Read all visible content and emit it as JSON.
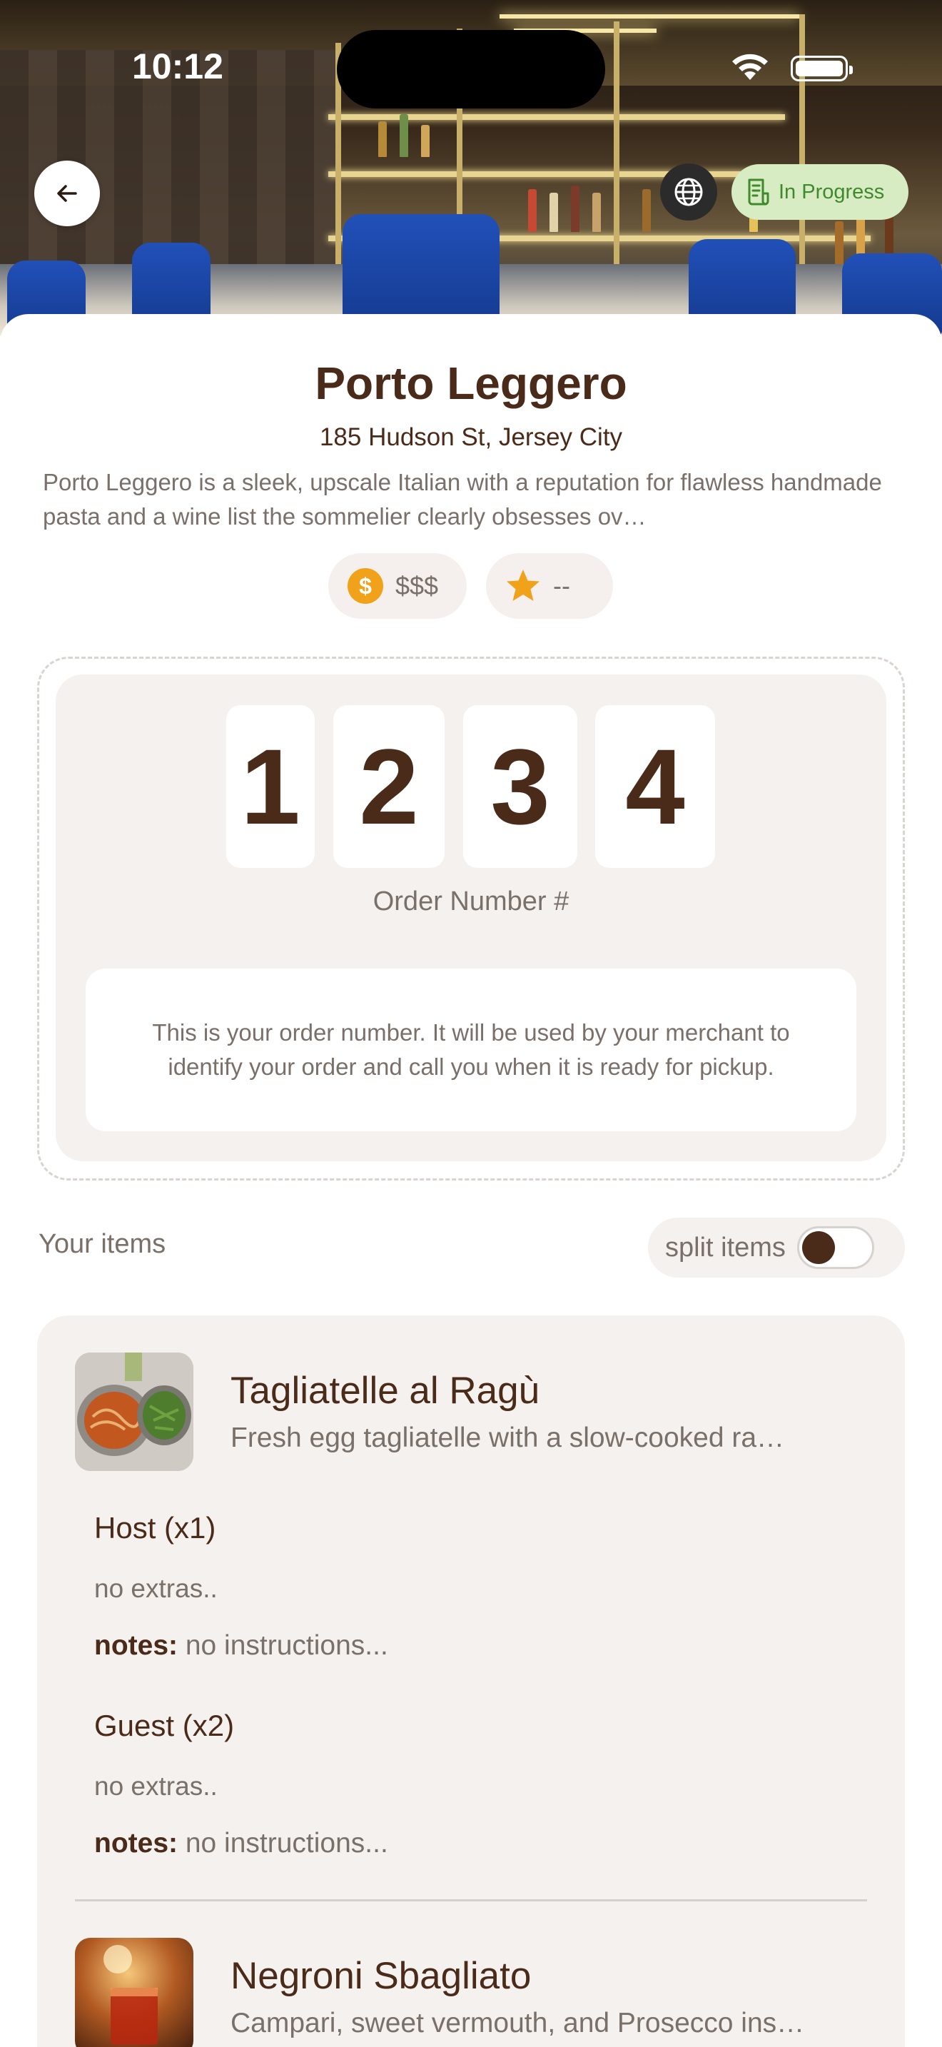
{
  "status_bar": {
    "time": "10:12"
  },
  "header": {
    "status_label": "In Progress",
    "back_icon": "arrow-left-icon",
    "globe_icon": "globe-icon",
    "receipt_icon": "receipt-icon"
  },
  "restaurant": {
    "name": "Porto Leggero",
    "address": "185 Hudson St, Jersey City",
    "description": "Porto Leggero is a sleek, upscale Italian with a reputation for flawless handmade pasta and a wine list the sommelier clearly obsesses ov…",
    "price_level": "$$$",
    "rating": "--"
  },
  "order": {
    "digits": [
      "1",
      "2",
      "3",
      "4"
    ],
    "label": "Order Number #",
    "note": "This is your order number. It will be used by your merchant to identify your order and call you when it is ready for pickup."
  },
  "items_section": {
    "title": "Your items",
    "split_label": "split items",
    "split_enabled": false
  },
  "items": [
    {
      "name": "Tagliatelle al Ragù",
      "description": "Fresh egg tagliatelle with a slow-cooked ra…",
      "groups": [
        {
          "who": "Host (x1)",
          "extras": "no extras..",
          "notes_key": "notes:",
          "notes_value": " no instructions..."
        },
        {
          "who": "Guest (x2)",
          "extras": "no extras..",
          "notes_key": "notes:",
          "notes_value": " no instructions..."
        }
      ]
    },
    {
      "name": "Negroni Sbagliato",
      "description": "Campari, sweet vermouth, and Prosecco ins…"
    }
  ],
  "colors": {
    "brand_brown": "#4a2a18",
    "muted_text": "#7a706a",
    "card_bg": "#f5f1ef",
    "status_green_bg": "#d8ecc4",
    "status_green_text": "#3f8a2c",
    "coin_orange": "#f0a21b",
    "star_orange": "#f0a21b"
  }
}
